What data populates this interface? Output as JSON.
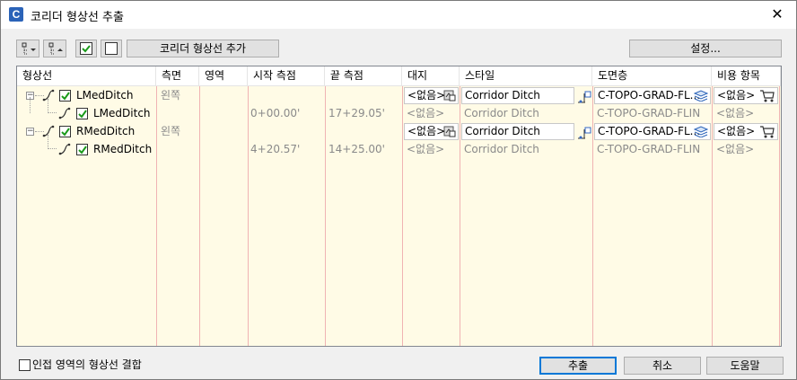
{
  "window": {
    "title": "코리더 형상선 추출",
    "close_glyph": "✕",
    "app_icon_letter": "C"
  },
  "toolbar": {
    "add_button": "코리더 형상선 추가",
    "settings_button": "설정..."
  },
  "columns": [
    "형상선",
    "측면",
    "영역",
    "시작 측점",
    "끝 측점",
    "대지",
    "스타일",
    "도면층",
    "비용 항목"
  ],
  "rows": [
    {
      "level": 0,
      "name": "LMedDitch",
      "side": "왼쪽",
      "start": "",
      "end": "",
      "site": "<없음>",
      "style": "Corridor Ditch",
      "layer": "C-TOPO-GRAD-FL...",
      "pay": "<없음>"
    },
    {
      "level": 1,
      "name": "LMedDitch",
      "side": "",
      "start": "0+00.00'",
      "end": "17+29.05'",
      "site": "<없음>",
      "style": "Corridor Ditch",
      "layer": "C-TOPO-GRAD-FLIN",
      "pay": "<없음>"
    },
    {
      "level": 0,
      "name": "RMedDitch",
      "side": "왼쪽",
      "start": "",
      "end": "",
      "site": "<없음>",
      "style": "Corridor Ditch",
      "layer": "C-TOPO-GRAD-FL...",
      "pay": "<없음>"
    },
    {
      "level": 1,
      "name": "RMedDitch",
      "side": "",
      "start": "4+20.57'",
      "end": "14+25.00'",
      "site": "<없음>",
      "style": "Corridor Ditch",
      "layer": "C-TOPO-GRAD-FLIN",
      "pay": "<없음>"
    }
  ],
  "footer": {
    "combine_label": "인접 영역의 형상선 결합",
    "combine_checked": false,
    "extract_button": "추출",
    "cancel_button": "취소",
    "help_button": "도움말"
  },
  "colors": {
    "grid_bg": "#fffbe6",
    "grid_line": "#f0b3b3",
    "check": "#1a9a1a",
    "accent": "#0078d7"
  }
}
